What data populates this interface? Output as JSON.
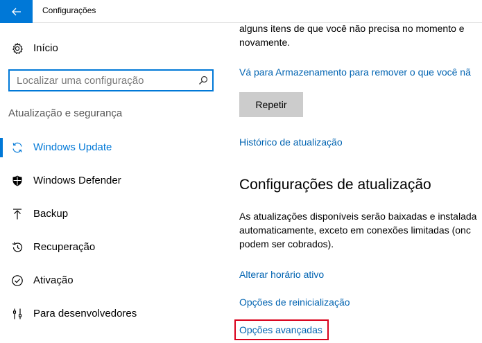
{
  "window": {
    "title": "Configurações"
  },
  "sidebar": {
    "home": {
      "label": "Início",
      "icon": "gear-icon"
    },
    "search": {
      "placeholder": "Localizar uma configuração",
      "value": ""
    },
    "section_header": "Atualização e segurança",
    "items": [
      {
        "label": "Windows Update",
        "icon": "sync-icon",
        "selected": true
      },
      {
        "label": "Windows Defender",
        "icon": "shield-icon",
        "selected": false
      },
      {
        "label": "Backup",
        "icon": "backup-arrow-icon",
        "selected": false
      },
      {
        "label": "Recuperação",
        "icon": "history-icon",
        "selected": false
      },
      {
        "label": "Ativação",
        "icon": "check-circle-icon",
        "selected": false
      },
      {
        "label": "Para desenvolvedores",
        "icon": "developer-tools-icon",
        "selected": false
      }
    ]
  },
  "main": {
    "intro_line1": "alguns itens de que você não precisa no momento e",
    "intro_line2": "novamente.",
    "storage_link": "Vá para Armazenamento para remover o que você nã",
    "retry_label": "Repetir",
    "history_link": "Histórico de atualização",
    "settings_title": "Configurações de atualização",
    "desc_line1": "As atualizações disponíveis serão baixadas e instalada",
    "desc_line2": "automaticamente, exceto em conexões limitadas (onc",
    "desc_line3": "podem ser cobrados).",
    "active_hours_link": "Alterar horário ativo",
    "restart_options_link": "Opções de reinicialização",
    "advanced_options_link": "Opções avançadas"
  },
  "colors": {
    "accent": "#0078d7",
    "link": "#0063b1",
    "highlight": "#d9001b"
  }
}
